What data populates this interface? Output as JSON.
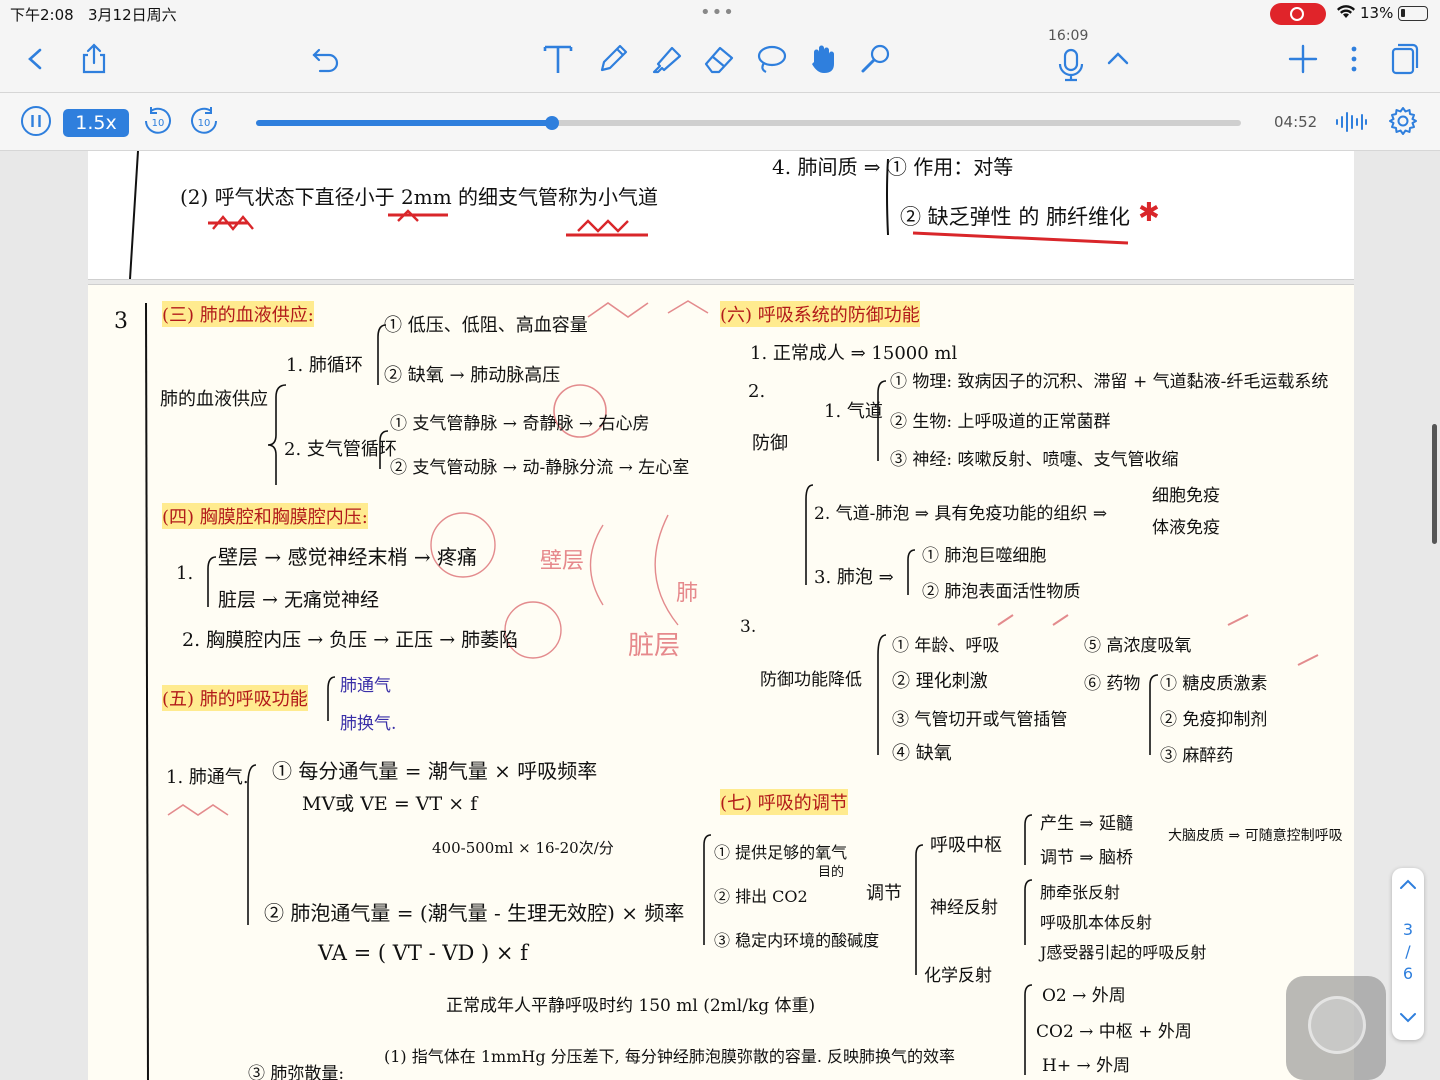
{
  "status_bar": {
    "time": "下午2:08",
    "date": "3月12日周六",
    "battery": "13%"
  },
  "toolbar": {
    "recording_time": "16:09"
  },
  "player": {
    "speed": "1.5x",
    "skip_back": "10",
    "skip_forward": "10",
    "duration": "04:52",
    "progress": 0.3
  },
  "notes": {
    "top": {
      "line_a": "(2) 呼气状态下直径小于 2mm 的细支气管称为小气道",
      "line_b": "4. 肺间质 ⇒ ① 作用：对等",
      "line_c": "② 缺乏弹性 的 肺纤维化"
    },
    "page_num": "3",
    "sec3": {
      "title": "(三) 肺的血液供应:",
      "root": "肺的血液供应",
      "b1": "1. 肺循环",
      "b1a": "① 低压、低阻、高血容量",
      "b1b": "② 缺氧 → 肺动脉高压",
      "b2": "2. 支气管循环",
      "b2a": "① 支气管静脉 → 奇静脉 → 右心房",
      "b2b": "② 支气管动脉 → 动-静脉分流 → 左心室"
    },
    "sec4": {
      "title": "(四) 胸膜腔和胸膜腔内压:",
      "n1": "1.",
      "a": "壁层 → 感觉神经末梢 → 疼痛",
      "b": "脏层 → 无痛觉神经",
      "c": "2. 胸膜腔内压 → 负压 → 正压 → 肺萎陷",
      "label_a": "壁层",
      "label_b": "脏层",
      "label_c": "肺"
    },
    "sec5": {
      "title": "(五) 肺的呼吸功能",
      "b1": "肺通气",
      "b2": "肺换气.",
      "v1": "1. 肺通气.",
      "f1": "① 每分通气量 = 潮气量 × 呼吸频率",
      "f1b": "MV或 VE = VT × f",
      "f1c": "400-500ml × 16-20次/分",
      "f2": "② 肺泡通气量 = (潮气量 - 生理无效腔) × 频率",
      "f2b": "VA = ( VT - VD ) × f",
      "f2c": "正常成年人平静呼吸时约 150 ml (2ml/kg 体重)",
      "f3": "③ 肺弥散量:",
      "f3a": "(1) 指气体在 1mmHg 分压差下, 每分钟经肺泡膜弥散的容量. 反映肺换气的效率"
    },
    "sec6": {
      "title": "(六) 呼吸系统的防御功能",
      "p1": "1. 正常成人 ⇒ 15000 ml",
      "p2": "2.",
      "def": "防御",
      "g1": "1. 气道",
      "g1a": "① 物理: 致病因子的沉积、滞留 + 气道黏液-纤毛运载系统",
      "g1b": "② 生物: 上呼吸道的正常菌群",
      "g1c": "③ 神经: 咳嗽反射、喷嚏、支气管收缩",
      "g2": "2. 气道-肺泡 ⇒ 具有免疫功能的组织 ⇒",
      "g2a": "细胞免疫",
      "g2b": "体液免疫",
      "g3": "3. 肺泡 ⇒",
      "g3a": "① 肺泡巨噬细胞",
      "g3b": "② 肺泡表面活性物质",
      "p3": "3.",
      "low": "防御功能降低",
      "l1": "① 年龄、呼吸",
      "l2": "② 理化刺激",
      "l3": "③ 气管切开或气管插管",
      "l4": "④ 缺氧",
      "l5": "⑤ 高浓度吸氧",
      "l6": "⑥ 药物",
      "l6a": "① 糖皮质激素",
      "l6b": "② 免疫抑制剂",
      "l6c": "③ 麻醉药"
    },
    "sec7": {
      "title": "(七) 呼吸的调节",
      "a": "① 提供足够的氧气",
      "a2": "目的",
      "b": "② 排出 CO2",
      "c": "③ 稳定内环境的酸碱度",
      "reg": "调节",
      "r1": "呼吸中枢",
      "r1a": "产生 ⇒ 延髓",
      "r1b": "调节 ⇒ 脑桥",
      "r1c": "大脑皮质 ⇒ 可随意控制呼吸",
      "r2": "神经反射",
      "r2a": "肺牵张反射",
      "r2b": "呼吸肌本体反射",
      "r2c": "J感受器引起的呼吸反射",
      "r3": "化学反射",
      "r3a": "O2 → 外周",
      "r3b": "CO2 → 中枢 + 外周",
      "r3c": "H+ → 外周"
    }
  },
  "pager": {
    "current": "3",
    "sep": "/",
    "total": "6"
  }
}
